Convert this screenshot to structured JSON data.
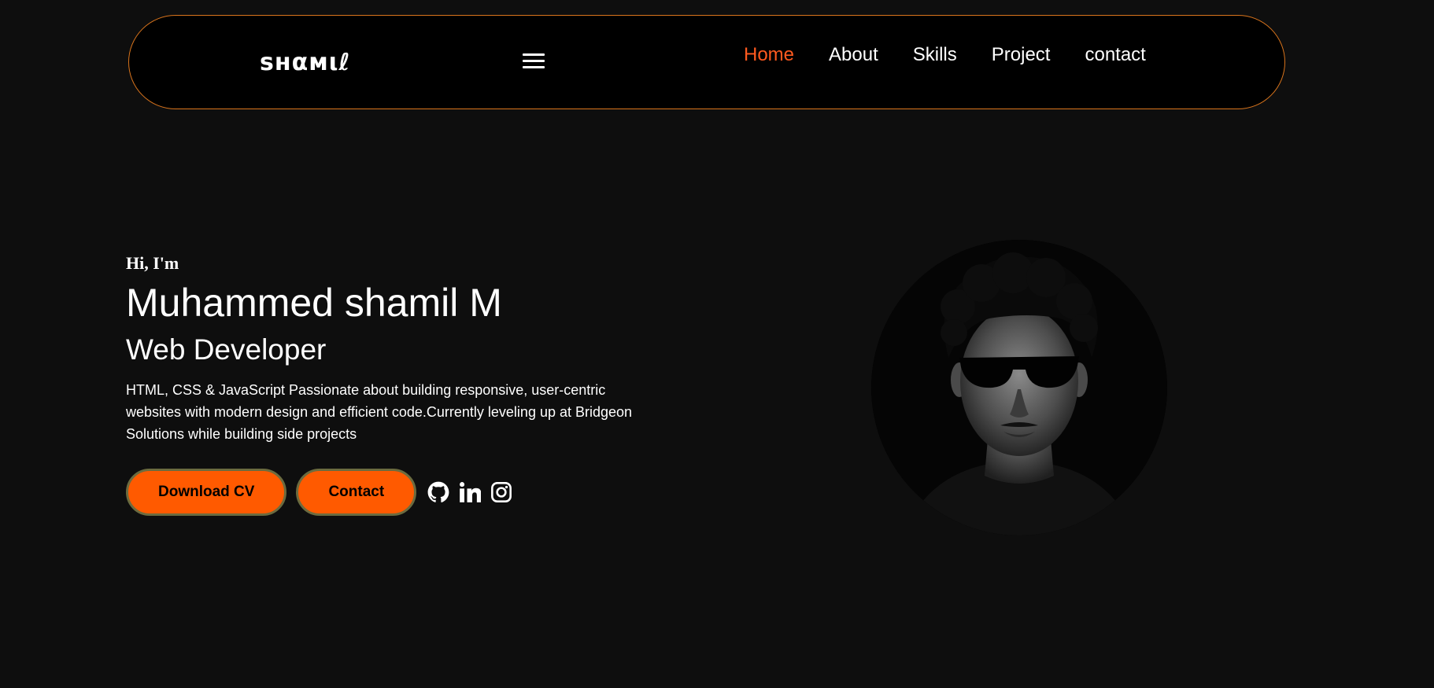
{
  "nav": {
    "logo": "sнαмιℓ",
    "links": [
      "Home",
      "About",
      "Skills",
      "Project",
      "contact"
    ],
    "active_color": "#ff5a1f",
    "border_color": "#d9741c"
  },
  "hero": {
    "greeting": "Hi, I'm",
    "name": "Muhammed shamil M",
    "role": "Web Developer",
    "description": "HTML, CSS & JavaScript Passionate about building responsive, user-centric websites with modern design and efficient code.Currently leveling up at Bridgeon Solutions while building side projects",
    "download_label": "Download CV",
    "contact_label": "Contact",
    "accent": "#ff5a00"
  },
  "social": {
    "icons": [
      "github-icon",
      "linkedin-icon",
      "instagram-icon"
    ]
  },
  "avatar": {
    "icon": "profile-photo"
  }
}
